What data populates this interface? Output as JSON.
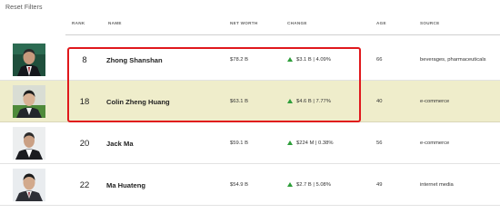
{
  "reset_filters": "Reset Filters",
  "columns": {
    "rank": "RANK",
    "name": "NAME",
    "net_worth": "NET WORTH",
    "change": "CHANGE",
    "age": "AGE",
    "source": "SOURCE"
  },
  "rows": [
    {
      "rank": "8",
      "name": "Zhong Shanshan",
      "net_worth": "$78.2 B",
      "change": "$3.1 B | 4.09%",
      "age": "66",
      "source": "beverages, pharmaceuticals"
    },
    {
      "rank": "18",
      "name": "Colin Zheng Huang",
      "net_worth": "$63.1 B",
      "change": "$4.6 B | 7.77%",
      "age": "40",
      "source": "e-commerce"
    },
    {
      "rank": "20",
      "name": "Jack Ma",
      "net_worth": "$59.1 B",
      "change": "$224 M | 0.38%",
      "age": "56",
      "source": "e-commerce"
    },
    {
      "rank": "22",
      "name": "Ma Huateng",
      "net_worth": "$54.9 B",
      "change": "$2.7 B | 5.08%",
      "age": "49",
      "source": "internet media"
    }
  ],
  "colors": {
    "highlight_row": "#efedcb",
    "annotation_box": "#e0181c",
    "change_up": "#2e9e3a"
  },
  "icons": {
    "change_up": "triangle-up-icon"
  }
}
